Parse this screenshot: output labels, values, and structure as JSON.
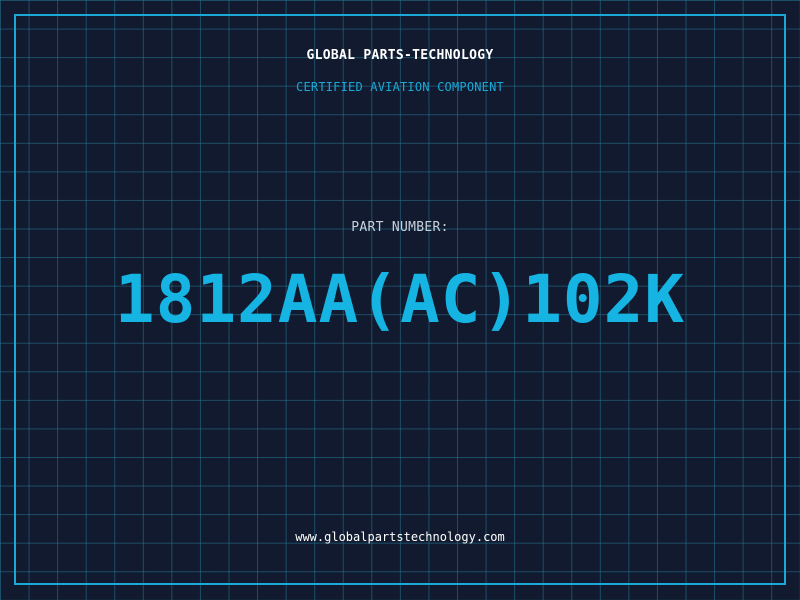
{
  "header": {
    "brand": "GLOBAL PARTS-TECHNOLOGY",
    "tagline": "CERTIFIED AVIATION COMPONENT"
  },
  "part": {
    "label": "PART NUMBER:",
    "number": "1812AA(AC)102K"
  },
  "footer": {
    "website": "www.globalpartstechnology.com"
  },
  "colors": {
    "background": "#111a2e",
    "grid": "#26788f",
    "accent": "#15b4e3",
    "frame": "#1ba8d6",
    "text": "#ffffff"
  }
}
